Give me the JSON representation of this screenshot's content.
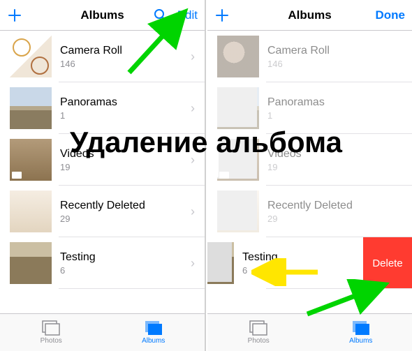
{
  "overlay_title": "Удаление альбома",
  "left": {
    "nav": {
      "title": "Albums",
      "edit": "Edit"
    },
    "albums": [
      {
        "title": "Camera Roll",
        "count": "146"
      },
      {
        "title": "Panoramas",
        "count": "1"
      },
      {
        "title": "Videos",
        "count": "19"
      },
      {
        "title": "Recently Deleted",
        "count": "29"
      },
      {
        "title": "Testing",
        "count": "6"
      }
    ],
    "tabs": {
      "photos": "Photos",
      "albums": "Albums"
    }
  },
  "right": {
    "nav": {
      "title": "Albums",
      "done": "Done"
    },
    "albums": [
      {
        "title": "Camera Roll",
        "count": "146"
      },
      {
        "title": "Panoramas",
        "count": "1"
      },
      {
        "title": "Videos",
        "count": "19"
      },
      {
        "title": "Recently Deleted",
        "count": "29"
      },
      {
        "title": "Testing",
        "count": "6"
      }
    ],
    "delete_label": "Delete",
    "tabs": {
      "photos": "Photos",
      "albums": "Albums"
    }
  }
}
